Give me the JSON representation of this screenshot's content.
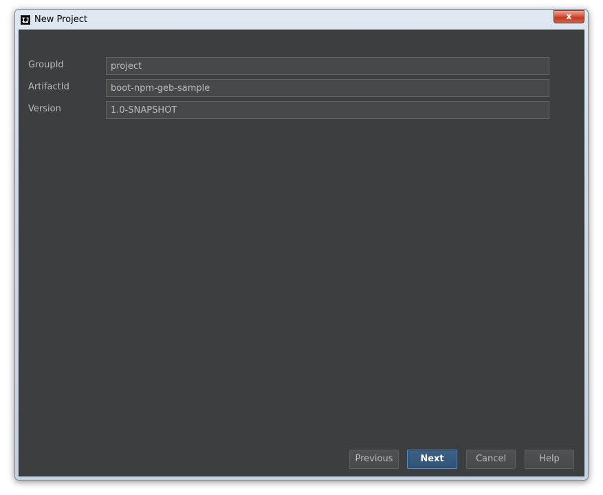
{
  "window": {
    "title": "New Project",
    "app_icon_text": "IJ",
    "close_symbol": "x"
  },
  "form": {
    "fields": [
      {
        "label": "GroupId",
        "value": "project"
      },
      {
        "label": "ArtifactId",
        "value": "boot-npm-geb-sample"
      },
      {
        "label": "Version",
        "value": "1.0-SNAPSHOT"
      }
    ]
  },
  "buttons": {
    "previous": "Previous",
    "next": "Next",
    "cancel": "Cancel",
    "help": "Help"
  },
  "colors": {
    "panel_bg": "#3c3f41",
    "input_bg": "#45494a",
    "text": "#bbbbbb",
    "primary_button": "#365880"
  }
}
